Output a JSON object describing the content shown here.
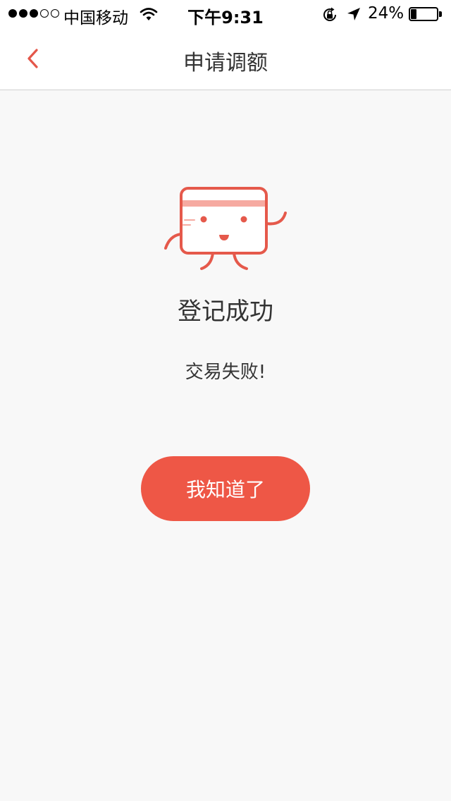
{
  "status_bar": {
    "carrier": "中国移动",
    "time": "下午9:31",
    "battery_percent": "24%",
    "signal_bars_filled": 3,
    "signal_bars_total": 5,
    "icons": [
      "wifi-icon",
      "rotation-lock-icon",
      "location-arrow-icon",
      "battery-icon"
    ]
  },
  "nav": {
    "back_icon": "chevron-left-icon",
    "title": "申请调额"
  },
  "result": {
    "illustration": "card-mascot-illustration",
    "title": "登记成功",
    "message": "交易失败!"
  },
  "actions": {
    "confirm_label": "我知道了"
  },
  "colors": {
    "accent": "#ee5746",
    "background": "#f8f8f8",
    "text": "#333333"
  }
}
